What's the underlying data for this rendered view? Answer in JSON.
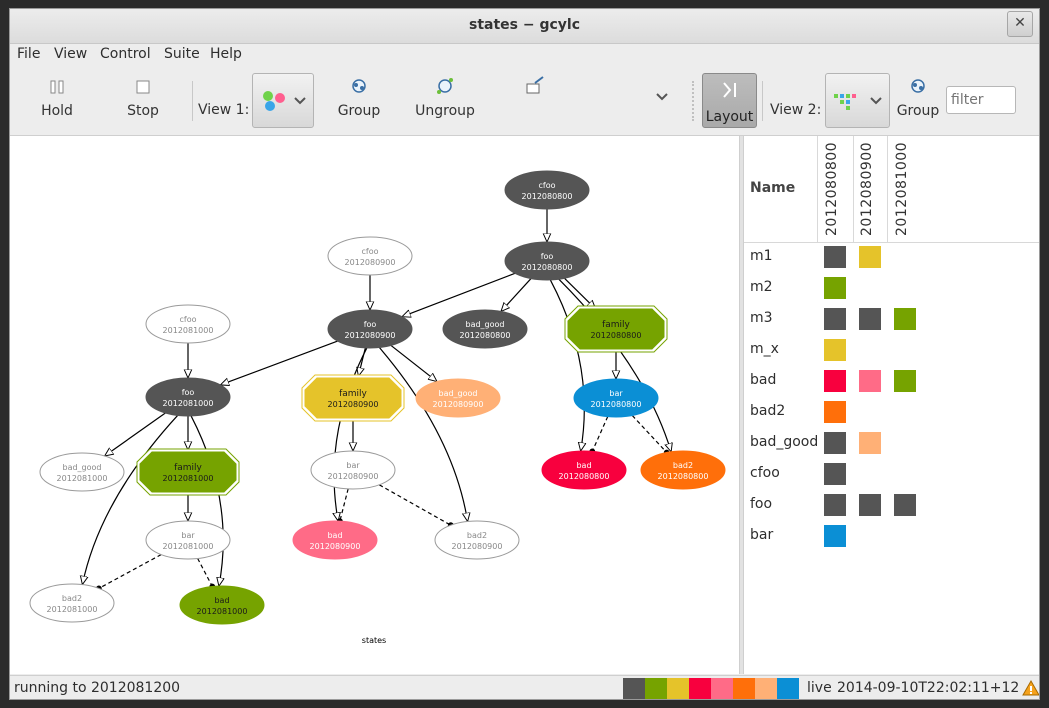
{
  "window": {
    "title": "states − gcylc"
  },
  "menu": [
    "File",
    "View",
    "Control",
    "Suite",
    "Help"
  ],
  "toolbar": {
    "hold": "Hold",
    "stop": "Stop",
    "view1_label": "View 1:",
    "group": "Group",
    "ungroup": "Ungroup",
    "layout": "Layout",
    "view2_label": "View 2:",
    "group2": "Group",
    "filter_placeholder": "filter"
  },
  "graph": {
    "caption": "states",
    "nodes": [
      {
        "id": "cfoo_800",
        "name": "cfoo",
        "cycle": "2012080800",
        "shape": "ellipse",
        "fill": "#555555",
        "text": "#ffffff",
        "stroke": "#555555"
      },
      {
        "id": "foo_800",
        "name": "foo",
        "cycle": "2012080800",
        "shape": "ellipse",
        "fill": "#555555",
        "text": "#ffffff",
        "stroke": "#555555"
      },
      {
        "id": "cfoo_900",
        "name": "cfoo",
        "cycle": "2012080900",
        "shape": "ellipse",
        "fill": "#ffffff",
        "text": "#888888",
        "stroke": "#9a9a9a"
      },
      {
        "id": "foo_900",
        "name": "foo",
        "cycle": "2012080900",
        "shape": "ellipse",
        "fill": "#555555",
        "text": "#ffffff",
        "stroke": "#555555"
      },
      {
        "id": "badgood_800",
        "name": "bad_good",
        "cycle": "2012080800",
        "shape": "ellipse",
        "fill": "#555555",
        "text": "#ffffff",
        "stroke": "#555555"
      },
      {
        "id": "family_800",
        "name": "family",
        "cycle": "2012080800",
        "shape": "octagon",
        "fill": "#76a300",
        "text": "#1a1a1a",
        "stroke": "#76a300"
      },
      {
        "id": "cfoo_1000",
        "name": "cfoo",
        "cycle": "2012081000",
        "shape": "ellipse",
        "fill": "#ffffff",
        "text": "#888888",
        "stroke": "#9a9a9a"
      },
      {
        "id": "foo_1000",
        "name": "foo",
        "cycle": "2012081000",
        "shape": "ellipse",
        "fill": "#555555",
        "text": "#ffffff",
        "stroke": "#555555"
      },
      {
        "id": "family_900",
        "name": "family",
        "cycle": "2012080900",
        "shape": "octagon",
        "fill": "#e5c32a",
        "text": "#1a1a1a",
        "stroke": "#e5c32a"
      },
      {
        "id": "badgood_900",
        "name": "bad_good",
        "cycle": "2012080900",
        "shape": "ellipse",
        "fill": "#ffb076",
        "text": "#ffffff",
        "stroke": "#ffb076"
      },
      {
        "id": "bar_800",
        "name": "bar",
        "cycle": "2012080800",
        "shape": "ellipse",
        "fill": "#0b8fd5",
        "text": "#ffffff",
        "stroke": "#0b8fd5"
      },
      {
        "id": "badgood_1000",
        "name": "bad_good",
        "cycle": "2012081000",
        "shape": "ellipse",
        "fill": "#ffffff",
        "text": "#888888",
        "stroke": "#9a9a9a"
      },
      {
        "id": "family_1000",
        "name": "family",
        "cycle": "2012081000",
        "shape": "octagon",
        "fill": "#76a300",
        "text": "#1a1a1a",
        "stroke": "#76a300"
      },
      {
        "id": "bar_900",
        "name": "bar",
        "cycle": "2012080900",
        "shape": "ellipse",
        "fill": "#ffffff",
        "text": "#888888",
        "stroke": "#9a9a9a"
      },
      {
        "id": "bad_800",
        "name": "bad",
        "cycle": "2012080800",
        "shape": "ellipse",
        "fill": "#f8003e",
        "text": "#ffffff",
        "stroke": "#f8003e"
      },
      {
        "id": "bad2_800",
        "name": "bad2",
        "cycle": "2012080800",
        "shape": "ellipse",
        "fill": "#ff6f0a",
        "text": "#ffffff",
        "stroke": "#ff6f0a"
      },
      {
        "id": "bar_1000",
        "name": "bar",
        "cycle": "2012081000",
        "shape": "ellipse",
        "fill": "#ffffff",
        "text": "#888888",
        "stroke": "#9a9a9a"
      },
      {
        "id": "bad_900",
        "name": "bad",
        "cycle": "2012080900",
        "shape": "ellipse",
        "fill": "#ff6b87",
        "text": "#ffffff",
        "stroke": "#ff6b87"
      },
      {
        "id": "bad2_900",
        "name": "bad2",
        "cycle": "2012080900",
        "shape": "ellipse",
        "fill": "#ffffff",
        "text": "#888888",
        "stroke": "#9a9a9a"
      },
      {
        "id": "bad2_1000",
        "name": "bad2",
        "cycle": "2012081000",
        "shape": "ellipse",
        "fill": "#ffffff",
        "text": "#888888",
        "stroke": "#9a9a9a"
      },
      {
        "id": "bad_1000",
        "name": "bad",
        "cycle": "2012081000",
        "shape": "ellipse",
        "fill": "#76a300",
        "text": "#1a1a1a",
        "stroke": "#76a300"
      }
    ],
    "edges": [
      {
        "from": "cfoo_800",
        "to": "foo_800",
        "style": "solid"
      },
      {
        "from": "foo_800",
        "to": "foo_900",
        "style": "solid"
      },
      {
        "from": "foo_800",
        "to": "badgood_800",
        "style": "solid"
      },
      {
        "from": "foo_800",
        "to": "family_800",
        "style": "solid"
      },
      {
        "from": "foo_800",
        "to": "bad_800",
        "style": "solid"
      },
      {
        "from": "foo_800",
        "to": "bad2_800",
        "style": "solid"
      },
      {
        "from": "family_800",
        "to": "bar_800",
        "style": "solid"
      },
      {
        "from": "bar_800",
        "to": "bad_800",
        "style": "dashed"
      },
      {
        "from": "bar_800",
        "to": "bad2_800",
        "style": "dashed"
      },
      {
        "from": "cfoo_900",
        "to": "foo_900",
        "style": "solid"
      },
      {
        "from": "foo_900",
        "to": "foo_1000",
        "style": "solid"
      },
      {
        "from": "foo_900",
        "to": "family_900",
        "style": "solid"
      },
      {
        "from": "foo_900",
        "to": "badgood_900",
        "style": "solid"
      },
      {
        "from": "foo_900",
        "to": "bad_900",
        "style": "solid"
      },
      {
        "from": "foo_900",
        "to": "bad2_900",
        "style": "solid"
      },
      {
        "from": "family_900",
        "to": "bar_900",
        "style": "solid"
      },
      {
        "from": "bar_900",
        "to": "bad_900",
        "style": "dashed"
      },
      {
        "from": "bar_900",
        "to": "bad2_900",
        "style": "dashed"
      },
      {
        "from": "cfoo_1000",
        "to": "foo_1000",
        "style": "solid"
      },
      {
        "from": "foo_1000",
        "to": "badgood_1000",
        "style": "solid"
      },
      {
        "from": "foo_1000",
        "to": "family_1000",
        "style": "solid"
      },
      {
        "from": "foo_1000",
        "to": "bad2_1000",
        "style": "solid"
      },
      {
        "from": "foo_1000",
        "to": "bad_1000",
        "style": "solid"
      },
      {
        "from": "family_1000",
        "to": "bar_1000",
        "style": "solid"
      },
      {
        "from": "bar_1000",
        "to": "bad2_1000",
        "style": "dashed"
      },
      {
        "from": "bar_1000",
        "to": "bad_1000",
        "style": "dashed"
      }
    ]
  },
  "grid": {
    "name_header": "Name",
    "cycles": [
      "2012080800",
      "2012080900",
      "2012081000"
    ],
    "rows": [
      {
        "name": "m1",
        "cells": [
          "#555555",
          "#e5c32a",
          null
        ]
      },
      {
        "name": "m2",
        "cells": [
          "#76a300",
          null,
          null
        ]
      },
      {
        "name": "m3",
        "cells": [
          "#555555",
          "#555555",
          "#76a300"
        ]
      },
      {
        "name": "m_x",
        "cells": [
          "#e5c32a",
          null,
          null
        ]
      },
      {
        "name": "bad",
        "cells": [
          "#f8003e",
          "#ff6b87",
          "#76a300"
        ]
      },
      {
        "name": "bad2",
        "cells": [
          "#ff6f0a",
          null,
          null
        ]
      },
      {
        "name": "bad_good",
        "cells": [
          "#555555",
          "#ffb076",
          null
        ]
      },
      {
        "name": "cfoo",
        "cells": [
          "#555555",
          null,
          null
        ]
      },
      {
        "name": "foo",
        "cells": [
          "#555555",
          "#555555",
          "#555555"
        ]
      },
      {
        "name": "bar",
        "cells": [
          "#0b8fd5",
          null,
          null
        ]
      }
    ]
  },
  "status": {
    "text": "running to 2012081200",
    "legend_colors": [
      "#555555",
      "#76a300",
      "#e5c32a",
      "#f8003e",
      "#ff6b87",
      "#ff6f0a",
      "#ffb076",
      "#0b8fd5"
    ],
    "mode": "live",
    "timestamp": "2014-09-10T22:02:11+12"
  }
}
